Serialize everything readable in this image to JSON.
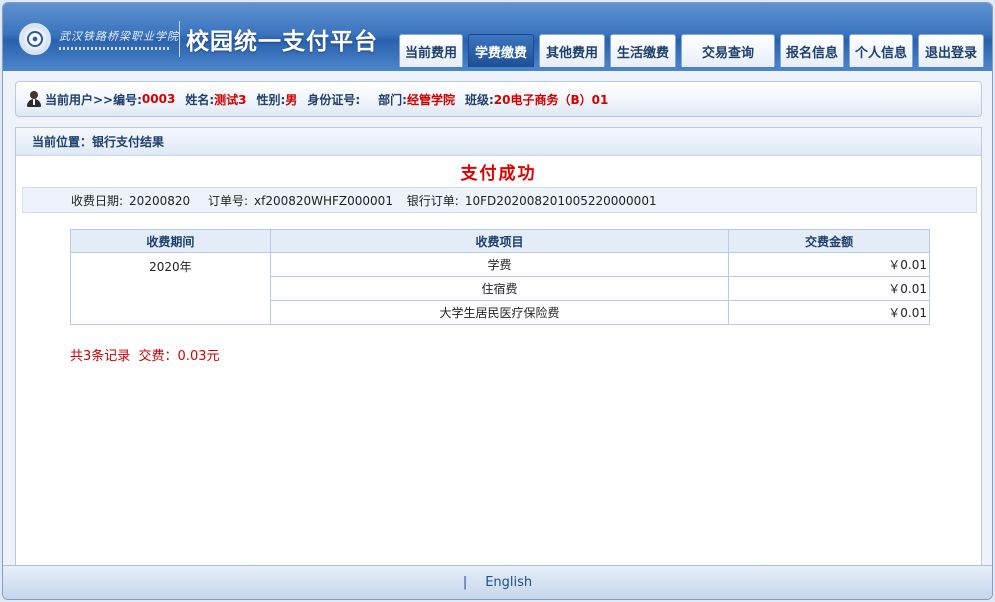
{
  "header": {
    "school_name": "武汉铁路桥梁职业学院",
    "platform_title": "校园统一支付平台"
  },
  "nav": [
    {
      "label": "当前费用",
      "name": "tab-current-fees",
      "active": false
    },
    {
      "label": "学费缴费",
      "name": "tab-tuition-payment",
      "active": true
    },
    {
      "label": "其他费用",
      "name": "tab-other-fees",
      "active": false
    },
    {
      "label": "生活缴费",
      "name": "tab-living-payment",
      "active": false
    },
    {
      "label": "交易查询",
      "name": "tab-transaction-query",
      "active": false
    },
    {
      "label": "报名信息",
      "name": "tab-registration-info",
      "active": false
    },
    {
      "label": "个人信息",
      "name": "tab-personal-info",
      "active": false
    },
    {
      "label": "退出登录",
      "name": "tab-logout",
      "active": false
    }
  ],
  "user": {
    "prefix": "当前用户>>编号:",
    "id": "0003",
    "name_label": "姓名:",
    "name": "测试3",
    "gender_label": "性别:",
    "gender": "男",
    "idcard_label": "身份证号:",
    "idcard": "",
    "dept_label": "部门:",
    "dept": "经管学院",
    "class_label": "班级:",
    "class": "20电子商务（B）01"
  },
  "breadcrumb": "当前位置：银行支付结果",
  "result_title": "支付成功",
  "info": {
    "date_label": "收费日期:",
    "date": "20200820",
    "order_label": "订单号:",
    "order": "xf200820WHFZ000001",
    "bank_order_label": "银行订单:",
    "bank_order": "10FD20200820100522000000​1"
  },
  "table": {
    "headers": [
      "收费期间",
      "收费项目",
      "交费金额"
    ],
    "period": "2020年",
    "rows": [
      {
        "item": "学费",
        "amount": "￥0.01"
      },
      {
        "item": "住宿费",
        "amount": "￥0.01"
      },
      {
        "item": "大学生居民医疗保险费",
        "amount": "￥0.01"
      }
    ]
  },
  "summary": "共3条记录  交费：0.03元",
  "footer": {
    "separator": "|",
    "english_link": "English"
  }
}
